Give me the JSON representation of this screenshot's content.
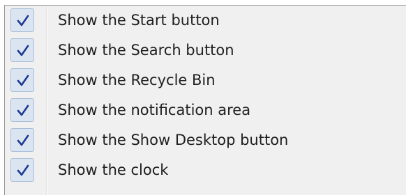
{
  "menu": {
    "items": [
      {
        "label": "Show the Start button",
        "checked": true
      },
      {
        "label": "Show the Search button",
        "checked": true
      },
      {
        "label": "Show the Recycle Bin",
        "checked": true
      },
      {
        "label": "Show the notification area",
        "checked": true
      },
      {
        "label": "Show the Show Desktop button",
        "checked": true
      },
      {
        "label": "Show the clock",
        "checked": true
      }
    ],
    "check_icon": "checkmark-icon",
    "check_color": "#1f3a93"
  }
}
